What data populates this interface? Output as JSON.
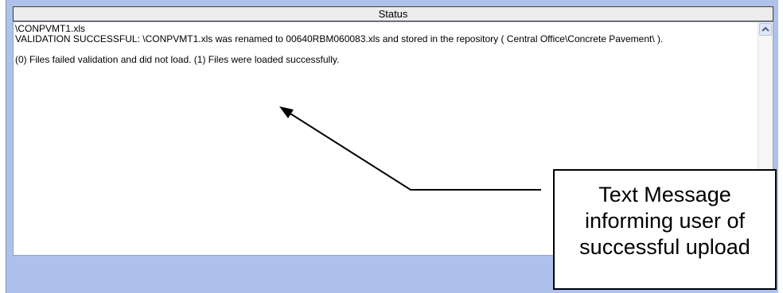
{
  "status_panel": {
    "header": "Status",
    "lines": [
      "\\CONPVMT1.xls",
      "VALIDATION SUCCESSFUL: \\CONPVMT1.xls was renamed to 00640RBM060083.xls and stored in the repository ( Central Office\\Concrete Pavement\\ ).",
      "",
      "(0) Files failed validation and did not load. (1) Files were loaded successfully."
    ]
  },
  "callout": {
    "lines": [
      "Text Message",
      "informing user of",
      "successful upload"
    ]
  },
  "colors": {
    "frame_background": "#aec1eb",
    "header_background": "#ececec",
    "callout_border": "#000000"
  }
}
